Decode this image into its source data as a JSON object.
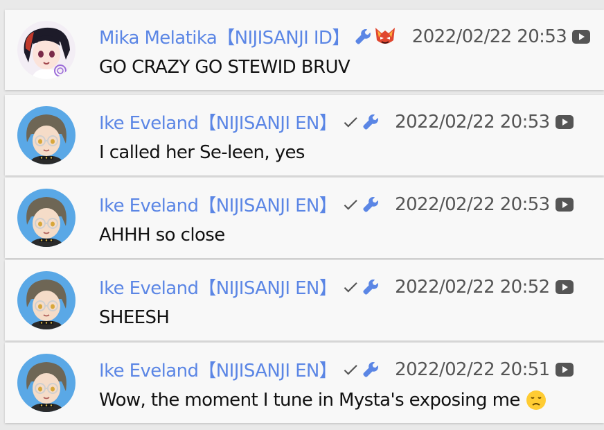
{
  "messages": [
    {
      "author": "Mika Melatika【NIJISANJI ID】",
      "timestamp": "2022/02/22 20:53",
      "text": "GO CRAZY GO STEWID BRUV",
      "verified": false,
      "moderator": true,
      "member_badge": true,
      "avatar": "mika-avatar"
    },
    {
      "author": "Ike Eveland【NIJISANJI EN】",
      "timestamp": "2022/02/22 20:53",
      "text": "I called her Se-leen, yes",
      "verified": true,
      "moderator": true,
      "member_badge": false,
      "avatar": "ike-avatar"
    },
    {
      "author": "Ike Eveland【NIJISANJI EN】",
      "timestamp": "2022/02/22 20:53",
      "text": "AHHH so close",
      "verified": true,
      "moderator": true,
      "member_badge": false,
      "avatar": "ike-avatar"
    },
    {
      "author": "Ike Eveland【NIJISANJI EN】",
      "timestamp": "2022/02/22 20:52",
      "text": "SHEESH",
      "verified": true,
      "moderator": true,
      "member_badge": false,
      "avatar": "ike-avatar"
    },
    {
      "author": "Ike Eveland【NIJISANJI EN】",
      "timestamp": "2022/02/22 20:51",
      "text": "Wow, the moment I tune in Mysta's exposing me",
      "verified": true,
      "moderator": true,
      "member_badge": false,
      "avatar": "ike-avatar",
      "trailing_emoji": "disappointed-face-emoji"
    }
  ],
  "colors": {
    "author": "#5b86e5",
    "timestamp": "#555555",
    "card": "#f8f8f8",
    "background": "#e9e9e9"
  },
  "icons": {
    "verified": "check-icon",
    "moderator": "wrench-icon",
    "source": "youtube-icon"
  }
}
